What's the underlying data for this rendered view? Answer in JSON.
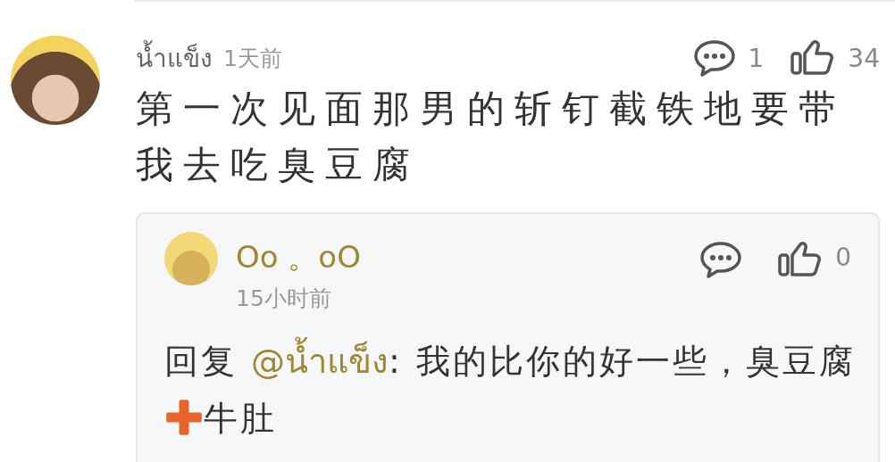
{
  "comment": {
    "author": "น้ำแข็ง",
    "time": "1天前",
    "reply_count": "1",
    "like_count": "34",
    "liked": false,
    "text": "第一次见面那男的斩钉截铁地要带我去吃臭豆腐"
  },
  "reply": {
    "author": "Oo 。oO",
    "time": "15小时前",
    "like_count": "0",
    "liked": false,
    "segments": [
      {
        "kind": "text",
        "text": "回复 "
      },
      {
        "kind": "mention",
        "text": "@น้ำแข็ง"
      },
      {
        "kind": "text",
        "text": ": 我的比你的好一些，臭豆腐"
      },
      {
        "kind": "plus_emoji"
      },
      {
        "kind": "text",
        "text": "牛肚"
      }
    ]
  }
}
